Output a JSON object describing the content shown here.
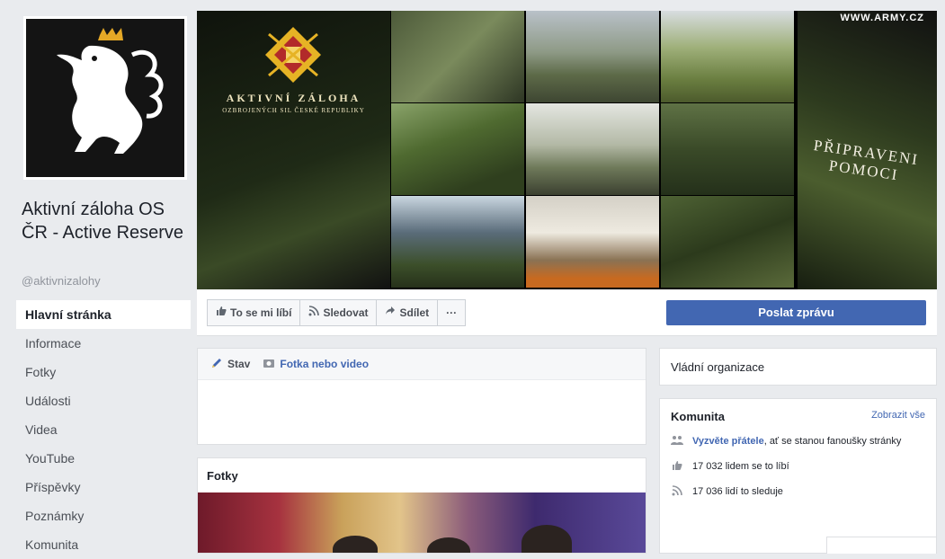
{
  "page": {
    "name": "Aktivní záloha OS ČR - Active Reserve",
    "handle": "@aktivnizalohy"
  },
  "nav": {
    "items": [
      {
        "label": "Hlavní stránka",
        "active": true
      },
      {
        "label": "Informace"
      },
      {
        "label": "Fotky"
      },
      {
        "label": "Události"
      },
      {
        "label": "Videa"
      },
      {
        "label": "YouTube"
      },
      {
        "label": "Příspěvky"
      },
      {
        "label": "Poznámky"
      },
      {
        "label": "Komunita"
      }
    ]
  },
  "cover": {
    "brand_line1": "AKTIVNÍ ZÁLOHA",
    "brand_line2": "OZBROJENÝCH SIL ČESKÉ REPUBLIKY",
    "website": "WWW.ARMY.CZ",
    "motto": "PŘIPRAVENI POMOCI"
  },
  "actions": {
    "like": "To se mi líbí",
    "follow": "Sledovat",
    "share": "Sdílet",
    "more": "···",
    "message": "Poslat zprávu"
  },
  "composer": {
    "status": "Stav",
    "photo_video": "Fotka nebo video"
  },
  "photos": {
    "title": "Fotky"
  },
  "sidebar": {
    "category": "Vládní organizace",
    "community": {
      "title": "Komunita",
      "see_all": "Zobrazit vše",
      "invite_link": "Vyzvěte přátele",
      "invite_rest": ", ať se stanou fanoušky stránky",
      "likes": "17 032 lidem se to líbí",
      "follows": "17 036 lidí to sleduje"
    }
  },
  "colors": {
    "accent": "#4267b2",
    "background": "#e9ebee"
  },
  "icons": {
    "like": "thumbs-up-icon",
    "follow": "rss-icon",
    "share": "share-arrow-icon",
    "status": "pencil-icon",
    "photo": "camera-icon",
    "invite": "people-icon",
    "likes": "thumbs-up-icon",
    "follows": "rss-icon"
  }
}
